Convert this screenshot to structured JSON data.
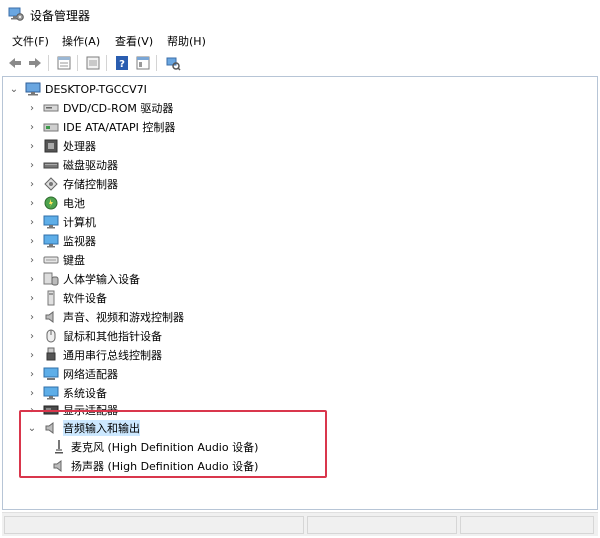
{
  "window": {
    "title": "设备管理器"
  },
  "menu": [
    "文件(F)",
    "操作(A)",
    "查看(V)",
    "帮助(H)"
  ],
  "toolbar": {
    "buttons": [
      "back-icon",
      "forward-icon",
      "properties-icon",
      "update-icon",
      "help-icon",
      "view-icon",
      "scan-icon"
    ]
  },
  "tree": {
    "root": {
      "label": "DESKTOP-TGCCV7I",
      "icon": "computer-icon",
      "expanded": true
    },
    "categories": [
      {
        "label": "DVD/CD-ROM 驱动器",
        "icon": "dvd-drive-icon",
        "expanded": false
      },
      {
        "label": "IDE ATA/ATAPI 控制器",
        "icon": "ide-controller-icon",
        "expanded": false
      },
      {
        "label": "处理器",
        "icon": "processor-icon",
        "expanded": false
      },
      {
        "label": "磁盘驱动器",
        "icon": "disk-drive-icon",
        "expanded": false
      },
      {
        "label": "存储控制器",
        "icon": "storage-controller-icon",
        "expanded": false
      },
      {
        "label": "电池",
        "icon": "battery-icon",
        "expanded": false
      },
      {
        "label": "计算机",
        "icon": "monitor-icon",
        "expanded": false
      },
      {
        "label": "监视器",
        "icon": "monitor-icon",
        "expanded": false
      },
      {
        "label": "键盘",
        "icon": "keyboard-icon",
        "expanded": false
      },
      {
        "label": "人体学输入设备",
        "icon": "hid-icon",
        "expanded": false
      },
      {
        "label": "软件设备",
        "icon": "software-device-icon",
        "expanded": false
      },
      {
        "label": "声音、视频和游戏控制器",
        "icon": "speaker-icon",
        "expanded": false
      },
      {
        "label": "鼠标和其他指针设备",
        "icon": "mouse-icon",
        "expanded": false
      },
      {
        "label": "通用串行总线控制器",
        "icon": "usb-icon",
        "expanded": false
      },
      {
        "label": "网络适配器",
        "icon": "network-adapter-icon",
        "expanded": false
      },
      {
        "label": "系统设备",
        "icon": "monitor-icon",
        "expanded": false
      },
      {
        "label": "显示适配器",
        "icon": "display-adapter-icon",
        "expanded": false
      },
      {
        "label": "音频输入和输出",
        "icon": "speaker-icon",
        "expanded": true,
        "selected": true,
        "children": [
          {
            "label": "麦克风 (High Definition Audio 设备)",
            "icon": "microphone-icon"
          },
          {
            "label": "扬声器 (High Definition Audio 设备)",
            "icon": "speaker-icon"
          }
        ]
      }
    ]
  },
  "colors": {
    "highlight_border": "#d9364c",
    "selection": "#cce8ff",
    "pane_border": "#b7c5d6"
  }
}
